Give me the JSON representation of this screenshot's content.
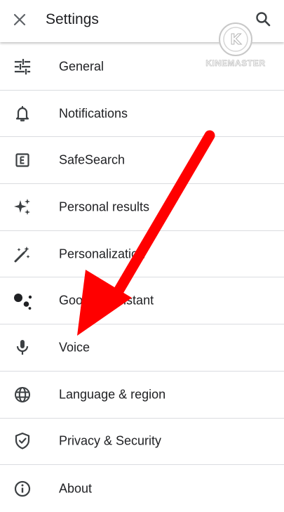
{
  "header": {
    "title": "Settings",
    "close_icon": "close-icon",
    "search_icon": "search-icon"
  },
  "watermark": {
    "text": "KINEMASTER",
    "logo_letter": "K"
  },
  "items": [
    {
      "label": "General",
      "icon": "tune-sliders-icon"
    },
    {
      "label": "Notifications",
      "icon": "bell-icon"
    },
    {
      "label": "SafeSearch",
      "icon": "explicit-e-icon"
    },
    {
      "label": "Personal results",
      "icon": "sparkle-icon"
    },
    {
      "label": "Personalization",
      "icon": "magic-wand-icon"
    },
    {
      "label": "Google Assistant",
      "icon": "assistant-dots-icon"
    },
    {
      "label": "Voice",
      "icon": "microphone-icon"
    },
    {
      "label": "Language & region",
      "icon": "globe-icon"
    },
    {
      "label": "Privacy & Security",
      "icon": "shield-check-icon"
    },
    {
      "label": "About",
      "icon": "info-icon"
    }
  ],
  "annotation": {
    "color": "#ff0000",
    "points_to": "Voice"
  }
}
